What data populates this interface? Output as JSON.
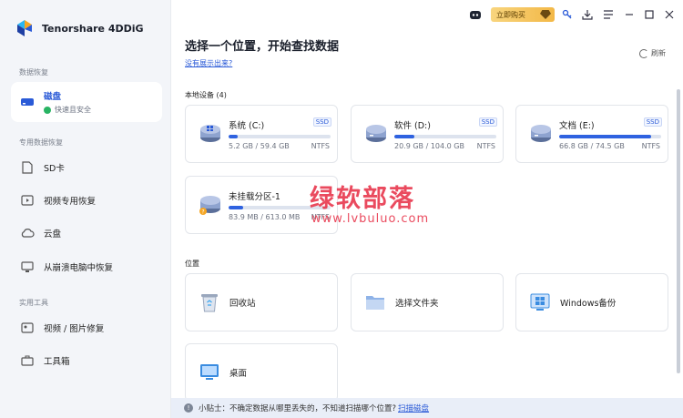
{
  "app": {
    "name": "Tenorshare 4DDiG"
  },
  "topbar": {
    "buy_label": "立即购买"
  },
  "sidebar": {
    "sections": [
      {
        "title": "数据恢复"
      },
      {
        "title": "专用数据恢复"
      },
      {
        "title": "实用工具"
      }
    ],
    "items": [
      {
        "label": "磁盘",
        "sub": "快速且安全",
        "icon": "hard-drive-icon"
      },
      {
        "label": "SD卡",
        "icon": "sd-card-icon"
      },
      {
        "label": "视频专用恢复",
        "icon": "video-icon"
      },
      {
        "label": "云盘",
        "icon": "cloud-icon"
      },
      {
        "label": "从崩溃电脑中恢复",
        "icon": "crashed-pc-icon"
      },
      {
        "label": "视频 / 图片修复",
        "icon": "repair-icon"
      },
      {
        "label": "工具箱",
        "icon": "toolbox-icon"
      }
    ]
  },
  "main": {
    "title": "选择一个位置，开始查找数据",
    "link": "没有展示出来?",
    "refresh": "刷新",
    "local_devices_label": "本地设备 (4)",
    "location_label": "位置",
    "disks": [
      {
        "name": "系统 (C:)",
        "tag": "SSD",
        "size": "5.2 GB / 59.4 GB",
        "fs": "NTFS",
        "used_fraction": 0.09,
        "warn": false
      },
      {
        "name": "软件 (D:)",
        "tag": "SSD",
        "size": "20.9 GB / 104.0 GB",
        "fs": "NTFS",
        "used_fraction": 0.2,
        "warn": false
      },
      {
        "name": "文档 (E:)",
        "tag": "SSD",
        "size": "66.8 GB / 74.5 GB",
        "fs": "NTFS",
        "used_fraction": 0.9,
        "warn": false
      },
      {
        "name": "未挂载分区-1",
        "tag": "",
        "size": "83.9 MB / 613.0 MB",
        "fs": "NTFS",
        "used_fraction": 0.14,
        "warn": true
      }
    ],
    "locations": [
      {
        "label": "回收站",
        "icon": "recycle-bin-icon"
      },
      {
        "label": "选择文件夹",
        "icon": "folder-icon"
      },
      {
        "label": "Windows备份",
        "icon": "windows-icon"
      },
      {
        "label": "桌面",
        "icon": "desktop-icon"
      }
    ]
  },
  "tip": {
    "text": "小贴士：不确定数据从哪里丢失的，不知道扫描哪个位置?",
    "link": "扫描磁盘"
  },
  "watermark": {
    "line1": "绿软部落",
    "line2": "www.lvbuluo.com"
  },
  "colors": {
    "accent": "#2a5ad7",
    "bar": "#2f62e0",
    "sidebar_bg": "#f3f5f9",
    "warning": "#f5a623"
  }
}
